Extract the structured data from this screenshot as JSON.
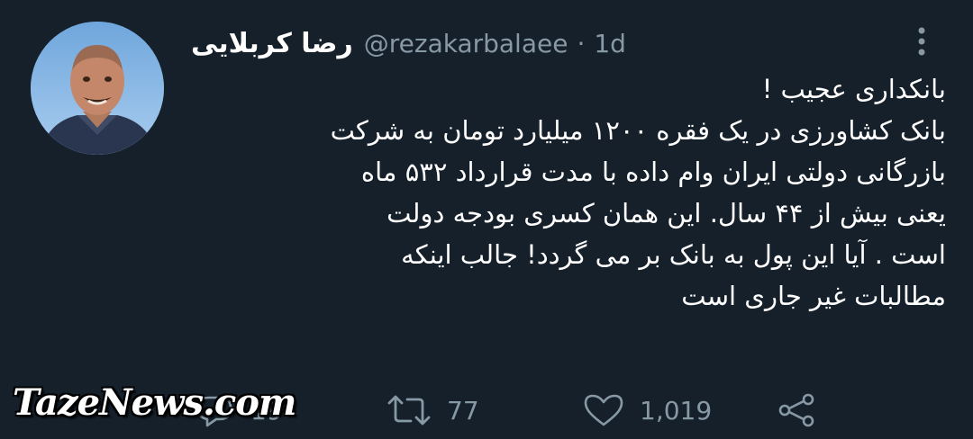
{
  "author": {
    "display_name": "رضا کربلایی",
    "handle": "@rezakarbalaee",
    "separator": "·",
    "time": "1d"
  },
  "tweet": {
    "lines": [
      "بانکداری عجیب !",
      "بانک کشاورزی در یک فقره ۱۲۰۰ میلیارد تومان به شرکت",
      "بازرگانی دولتی ایران وام داده با مدت قرارداد ۵۳۲ ماه",
      "یعنی بیش از ۴۴ سال. این همان کسری بودجه دولت",
      "است . آیا این پول به بانک بر می گردد! جالب اینکه",
      "مطالبات غیر جاری است"
    ]
  },
  "actions": {
    "reply_count": "19",
    "retweet_count": "77",
    "like_count": "1,019"
  },
  "watermark": {
    "text": "TazeNews.com"
  },
  "icons": {
    "more": "more-vertical-icon",
    "reply": "reply-icon",
    "retweet": "retweet-icon",
    "like": "heart-icon",
    "share": "share-icon"
  },
  "colors": {
    "background": "#15202b",
    "text": "#ffffff",
    "secondary": "#8899a6"
  }
}
